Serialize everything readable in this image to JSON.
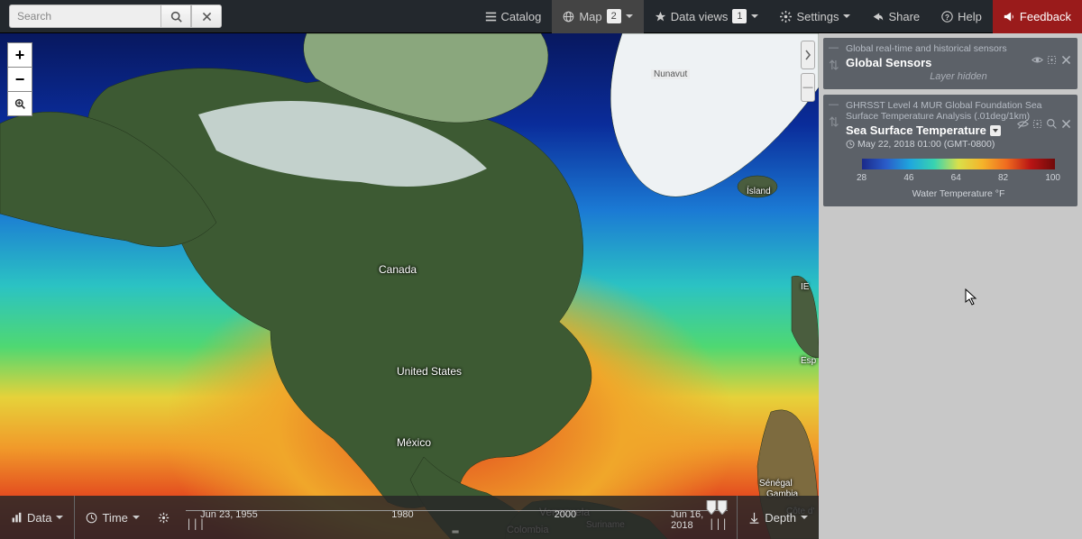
{
  "search": {
    "placeholder": "Search"
  },
  "nav": {
    "catalog": "Catalog",
    "map": "Map",
    "map_badge": "2",
    "dataviews": "Data views",
    "dataviews_badge": "1",
    "settings": "Settings",
    "share": "Share",
    "help": "Help",
    "feedback": "Feedback"
  },
  "map": {
    "labels": {
      "canada": "Canada",
      "us": "United States",
      "mexico": "México",
      "venezuela": "Venezuela",
      "colombia": "Colombia",
      "suriname": "Suriname",
      "nunavut": "Nunavut",
      "island": "Ísland",
      "ie": "IE",
      "esp": "Esp",
      "senegal": "Sénégal",
      "gambia": "Gambia",
      "cote": "Côte d'"
    }
  },
  "bottom": {
    "data": "Data",
    "time": "Time",
    "depth": "Depth",
    "t_start": "Jun 23, 1955",
    "t_mid1": "1980",
    "t_mid2": "2000",
    "t_end": "Jun 16, 2018"
  },
  "layers": [
    {
      "subtitle": "Global real-time and historical sensors",
      "title": "Global Sensors",
      "hidden_note": "Layer hidden"
    },
    {
      "subtitle": "GHRSST Level 4 MUR Global Foundation Sea Surface Temperature Analysis (.01deg/1km)",
      "title": "Sea Surface Temperature",
      "timestamp": "May 22, 2018 01:00 (GMT-0800)",
      "legend_ticks": [
        "28",
        "46",
        "64",
        "82",
        "100"
      ],
      "legend_label": "Water Temperature °F"
    }
  ]
}
